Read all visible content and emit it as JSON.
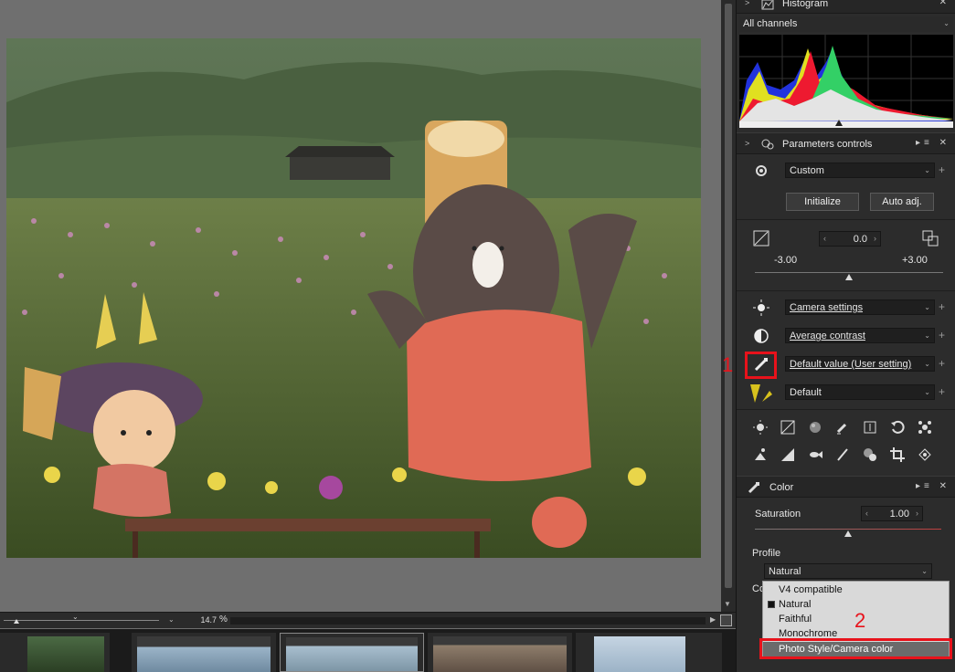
{
  "histogram": {
    "title": "Histogram",
    "channel": "All channels"
  },
  "params": {
    "title": "Parameters controls",
    "preset": "Custom",
    "initialize_label": "Initialize",
    "auto_adj_label": "Auto adj.",
    "exposure_value": "0.0",
    "range_min": "-3.00",
    "range_max": "+3.00",
    "exposure_level": 0.5,
    "brightness_mode": "Camera settings",
    "contrast_mode": "Average contrast",
    "picture_style": "Default value (User setting)",
    "filter_mode": "Default"
  },
  "color": {
    "title": "Color",
    "saturation_label": "Saturation",
    "saturation_value": "1.00",
    "saturation_level": 0.5,
    "profile_label": "Profile",
    "profile_value": "Natural",
    "obscured_label": "Co",
    "profile_options": [
      "V4 compatible",
      "Natural",
      "Faithful",
      "Monochrome",
      "Photo Style/Camera color"
    ],
    "selected_option": "Natural",
    "highlighted_option": "Photo Style/Camera color"
  },
  "viewer": {
    "zoom_value": "14.7",
    "zoom_unit": "%"
  },
  "annotations": {
    "label_1": "1",
    "label_2": "2",
    "accent": "#e8121b"
  }
}
